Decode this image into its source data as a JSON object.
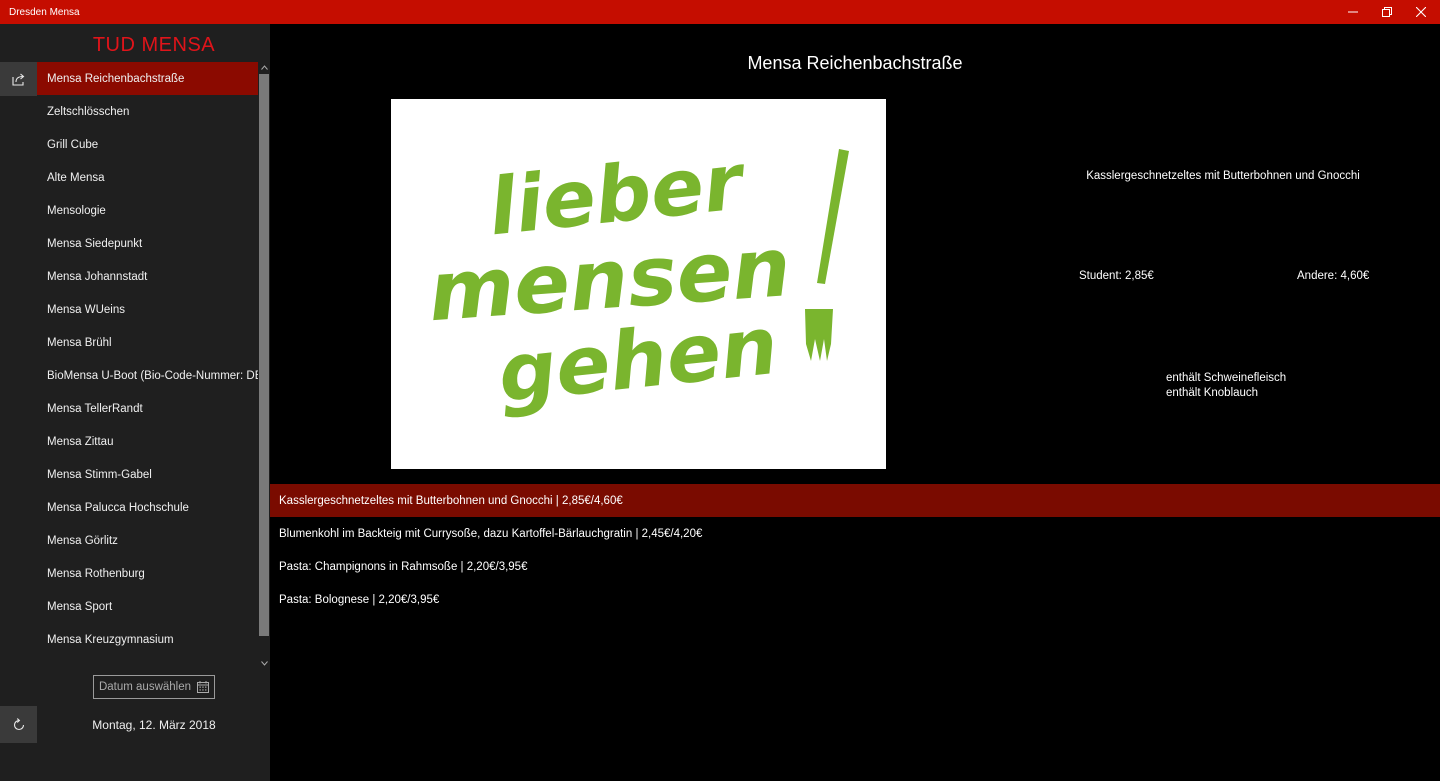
{
  "window": {
    "title": "Dresden Mensa"
  },
  "sidebar": {
    "brand": "TUD MENSA",
    "items": [
      {
        "label": "Mensa Reichenbachstraße",
        "selected": true
      },
      {
        "label": "Zeltschlösschen"
      },
      {
        "label": "Grill Cube"
      },
      {
        "label": "Alte Mensa"
      },
      {
        "label": "Mensologie"
      },
      {
        "label": "Mensa Siedepunkt"
      },
      {
        "label": "Mensa Johannstadt"
      },
      {
        "label": "Mensa WUeins"
      },
      {
        "label": "Mensa Brühl"
      },
      {
        "label": "BioMensa U-Boot (Bio-Code-Nummer: DE-"
      },
      {
        "label": "Mensa TellerRandt"
      },
      {
        "label": "Mensa Zittau"
      },
      {
        "label": "Mensa Stimm-Gabel"
      },
      {
        "label": "Mensa Palucca Hochschule"
      },
      {
        "label": "Mensa Görlitz"
      },
      {
        "label": "Mensa Rothenburg"
      },
      {
        "label": "Mensa Sport"
      },
      {
        "label": "Mensa Kreuzgymnasium"
      }
    ],
    "date_picker_label": "Datum auswählen",
    "current_date": "Montag, 12. März 2018",
    "icons": {
      "share": "share-icon",
      "refresh": "refresh-icon",
      "calendar": "calendar-icon"
    }
  },
  "main": {
    "title": "Mensa Reichenbachstraße",
    "logo_text": [
      "lieber",
      "mensen",
      "gehen"
    ],
    "detail": {
      "name": "Kasslergeschnetzeltes mit Butterbohnen und Gnocchi",
      "student_price": "Student: 2,85€",
      "other_price": "Andere: 4,60€",
      "notes": [
        "enthält Schweinefleisch",
        "enthält Knoblauch"
      ]
    },
    "meals": [
      {
        "label": "Kasslergeschnetzeltes mit Butterbohnen und Gnocchi  | 2,85€/4,60€",
        "selected": true
      },
      {
        "label": "Blumenkohl im Backteig mit Currysoße, dazu Kartoffel-Bärlauchgratin  | 2,45€/4,20€"
      },
      {
        "label": "Pasta: Champignons in Rahmsoße  | 2,20€/3,95€"
      },
      {
        "label": "Pasta: Bolognese  | 2,20€/3,95€"
      }
    ]
  },
  "colors": {
    "titlebar": "#c50d00",
    "accent": "#e0141a",
    "selected_sidebar": "#8b0a00",
    "selected_meal": "#7a0b00",
    "logo_green": "#7ab52e"
  }
}
